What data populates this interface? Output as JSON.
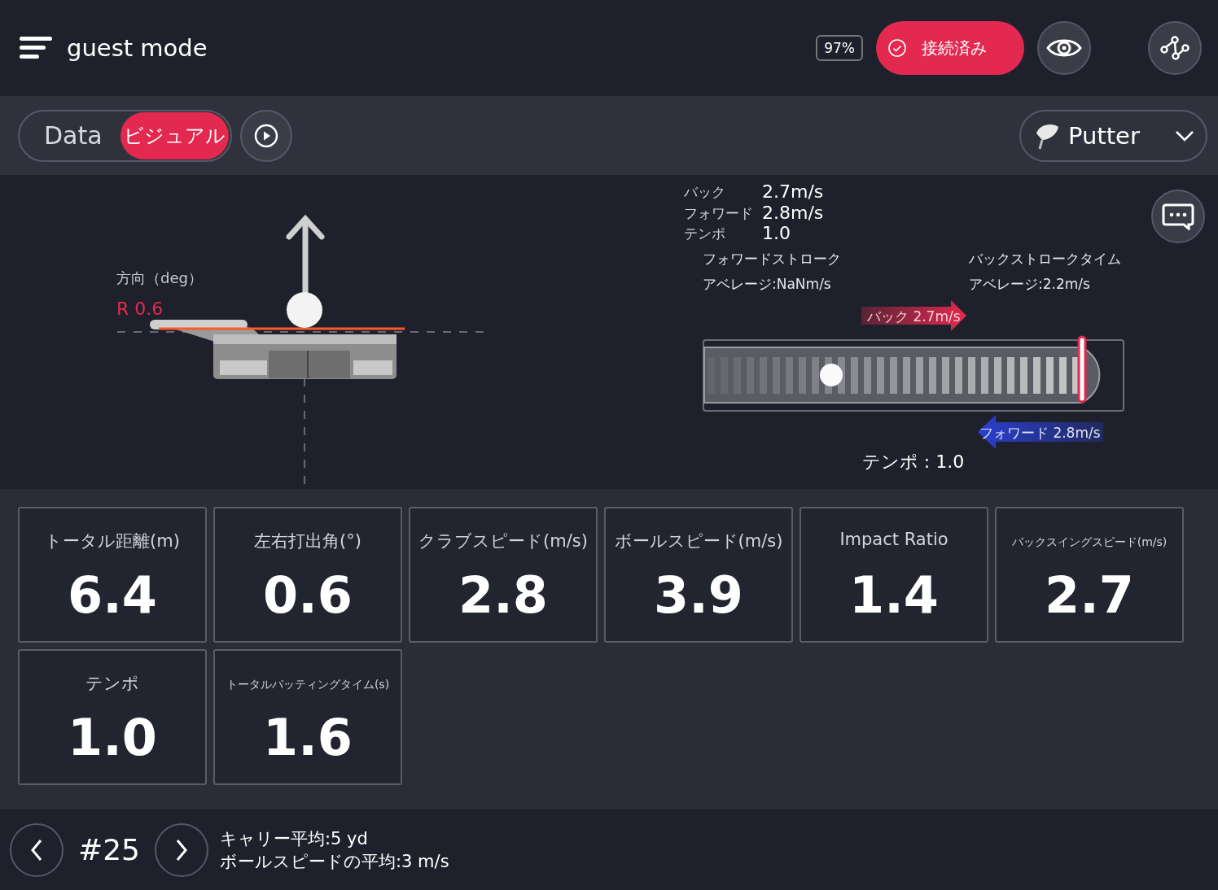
{
  "header": {
    "title": "guest mode",
    "battery": "97%",
    "connection": "接続済み"
  },
  "toolbar": {
    "view_tabs": [
      {
        "label": "Data",
        "selected": false
      },
      {
        "label": "ビジュアル",
        "selected": true
      }
    ],
    "club": "Putter"
  },
  "direction": {
    "label": "方向（deg）",
    "value": "R 0.6"
  },
  "stroke_speeds": [
    {
      "label": "バック",
      "value": "2.7m/s"
    },
    {
      "label": "フォワード",
      "value": "2.8m/s"
    },
    {
      "label": "テンポ",
      "value": "1.0"
    }
  ],
  "stroke_stats": [
    {
      "title": "フォワードストローク",
      "average": "アベレージ:NaNm/s"
    },
    {
      "title": "バックストロークタイム",
      "average": "アベレージ:2.2m/s"
    }
  ],
  "track": {
    "back_label": "バック 2.7m/s",
    "forward_label": "フォワード 2.8m/s",
    "tempo": "テンポ : 1.0"
  },
  "metrics": [
    {
      "label": "トータル距離(m)",
      "value": "6.4"
    },
    {
      "label": "左右打出角(°)",
      "value": "0.6"
    },
    {
      "label": "クラブスピード(m/s)",
      "value": "2.8"
    },
    {
      "label": "ボールスピード(m/s)",
      "value": "3.9"
    },
    {
      "label": "Impact Ratio",
      "value": "1.4"
    },
    {
      "label": "バックスイングスピード(m/s)",
      "value": "2.7"
    },
    {
      "label": "テンポ",
      "value": "1.0"
    },
    {
      "label": "トータルパッティングタイム(s)",
      "value": "1.6"
    }
  ],
  "footer": {
    "shot": "#25",
    "carry_average": "キャリー平均:5 yd",
    "ball_speed_average": "ボールスピードの平均:3 m/s"
  }
}
